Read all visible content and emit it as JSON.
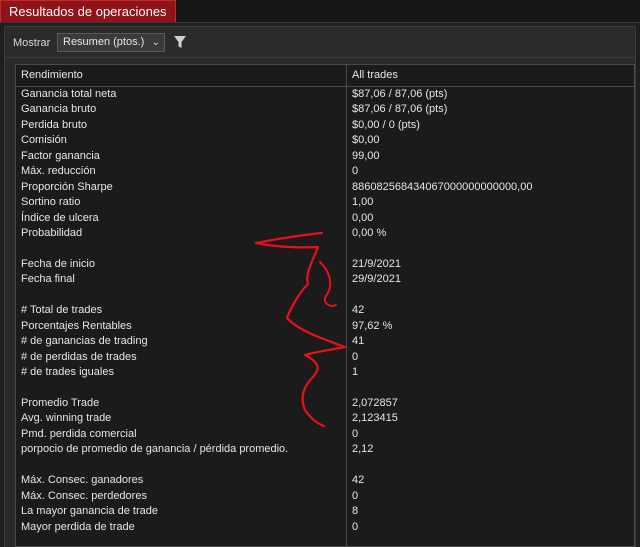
{
  "tab": {
    "title": "Resultados de operaciones"
  },
  "toolbar": {
    "label": "Mostrar",
    "select_value": "Resumen (ptos.)"
  },
  "table": {
    "headers": [
      "Rendimiento",
      "All trades"
    ],
    "rows": [
      [
        "Ganancia total neta",
        "$87,06 / 87,06 (pts)"
      ],
      [
        "Ganancia bruto",
        "$87,06 / 87,06 (pts)"
      ],
      [
        "Perdida bruto",
        "$0,00 / 0 (pts)"
      ],
      [
        "Comisión",
        "$0,00"
      ],
      [
        "Factor ganancia",
        "99,00"
      ],
      [
        "Máx. reducción",
        "0"
      ],
      [
        "Proporción Sharpe",
        "886082568434067000000000000,00"
      ],
      [
        "Sortino ratio",
        "1,00"
      ],
      [
        "Índice de ulcera",
        "0,00"
      ],
      [
        "Probabilidad",
        "0,00 %"
      ],
      [
        "",
        ""
      ],
      [
        "Fecha de inicio",
        "21/9/2021"
      ],
      [
        "Fecha final",
        "29/9/2021"
      ],
      [
        "",
        ""
      ],
      [
        "# Total de trades",
        "42"
      ],
      [
        "Porcentajes Rentables",
        "97,62 %"
      ],
      [
        "# de ganancias de trading",
        "41"
      ],
      [
        "# de perdidas de trades",
        "0"
      ],
      [
        "# de trades iguales",
        "1"
      ],
      [
        "",
        ""
      ],
      [
        "Promedio Trade",
        "2,072857"
      ],
      [
        "Avg. winning trade",
        "2,123415"
      ],
      [
        "Pmd. perdida comercial",
        "0"
      ],
      [
        "porpocio de promedio de ganancia / pérdida promedio.",
        "2,12"
      ],
      [
        "",
        ""
      ],
      [
        "Máx. Consec. ganadores",
        "42"
      ],
      [
        "Máx. Consec. perdedores",
        "0"
      ],
      [
        "La mayor ganancia de trade",
        "8"
      ],
      [
        "Mayor perdida de trade",
        "0"
      ]
    ]
  },
  "colors": {
    "tab_red": "#8e1418",
    "scribble_red": "#e8101a"
  },
  "icons": {
    "filter": "filter-icon",
    "dropdown": "chevron-down-icon"
  }
}
